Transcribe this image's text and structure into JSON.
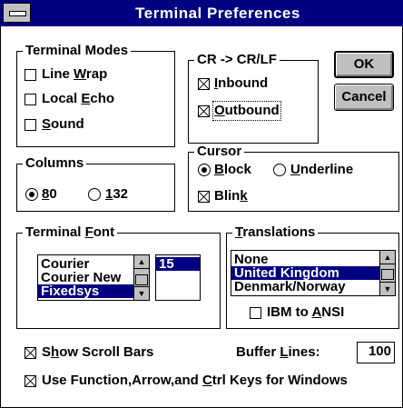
{
  "window": {
    "title": "Terminal Preferences"
  },
  "terminal_modes": {
    "label": "Terminal Modes",
    "line_wrap": {
      "pre": "Line ",
      "key": "W",
      "post": "rap",
      "checked": false
    },
    "local_echo": {
      "pre": "Local ",
      "key": "E",
      "post": "cho",
      "checked": false
    },
    "sound": {
      "pre": "",
      "key": "S",
      "post": "ound",
      "checked": false
    }
  },
  "cr_lf": {
    "label": "CR -> CR/LF",
    "inbound": {
      "pre": "",
      "key": "I",
      "post": "nbound",
      "checked": true
    },
    "outbound": {
      "pre": "",
      "key": "O",
      "post": "utbound",
      "checked": true
    }
  },
  "buttons": {
    "ok": "OK",
    "cancel": "Cancel"
  },
  "columns": {
    "label": "Columns",
    "opt80": {
      "pre": "",
      "key": "8",
      "post": "0",
      "selected": true
    },
    "opt132": {
      "pre": "",
      "key": "1",
      "post": "32",
      "selected": false
    }
  },
  "cursor": {
    "label": "Cursor",
    "block": {
      "pre": "",
      "key": "B",
      "post": "lock",
      "selected": true
    },
    "underline": {
      "pre": "",
      "key": "U",
      "post": "nderline",
      "selected": false
    },
    "blink": {
      "pre": "Blin",
      "key": "k",
      "post": "",
      "checked": true
    }
  },
  "terminal_font": {
    "label_pre": "Terminal ",
    "label_key": "F",
    "label_post": "ont",
    "fonts": [
      "Courier",
      "Courier New",
      "Fixedsys"
    ],
    "selected_font": "Fixedsys",
    "sizes": [
      "15"
    ],
    "selected_size": "15"
  },
  "translations": {
    "label_pre": "",
    "label_key": "T",
    "label_post": "ranslations",
    "items": [
      "None",
      "United Kingdom",
      "Denmark/Norway"
    ],
    "selected": "United Kingdom",
    "ibm_to_ansi": {
      "pre": "IBM to ",
      "key": "A",
      "post": "NSI",
      "checked": false
    }
  },
  "show_scroll_bars": {
    "pre": "S",
    "key": "h",
    "post": "ow Scroll Bars",
    "checked": true
  },
  "buffer_lines": {
    "pre": "Buffer ",
    "key": "L",
    "post": "ines:",
    "value": "100"
  },
  "function_keys": {
    "pre": "Use Function,Arrow,and ",
    "key": "C",
    "post": "trl Keys for Windows",
    "checked": true
  }
}
